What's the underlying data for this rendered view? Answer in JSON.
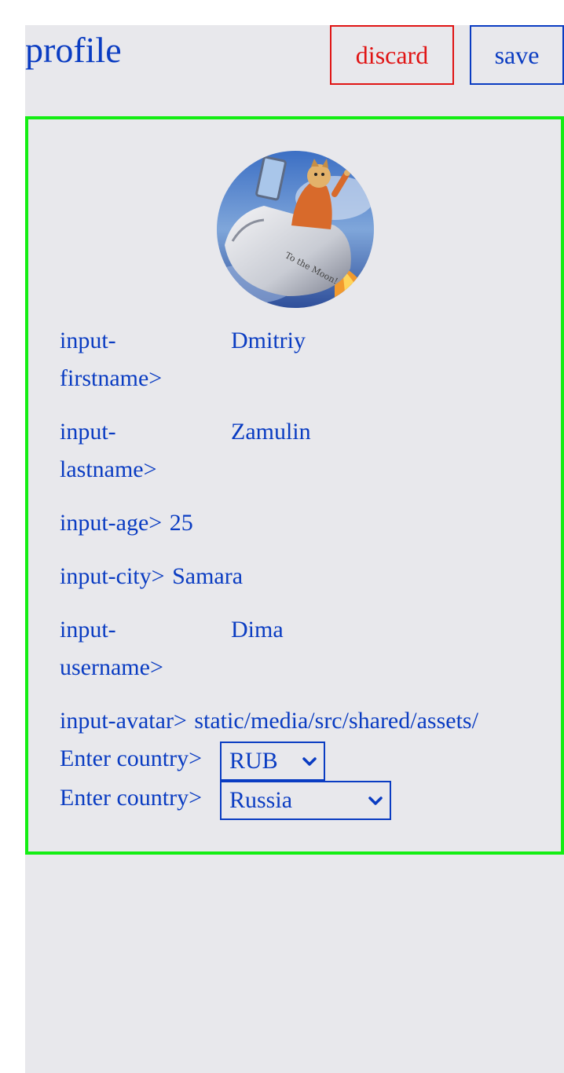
{
  "header": {
    "title": "profile",
    "discard_label": "discard",
    "save_label": "save"
  },
  "profile": {
    "avatar_icon": "doge-rocket-avatar",
    "firstname": {
      "label_line1": "input-",
      "label_line2": "firstname>",
      "value": "Dmitriy"
    },
    "lastname": {
      "label_line1": "input-",
      "label_line2": "lastname>",
      "value": "Zamulin"
    },
    "age": {
      "label": "input-age>",
      "value": "25"
    },
    "city": {
      "label": "input-city>",
      "value": "Samara"
    },
    "username": {
      "label_line1": "input-",
      "label_line2": "username>",
      "value": "Dima"
    },
    "avatar": {
      "label": "input-avatar>",
      "value": "static/media/src/shared/assets/"
    },
    "currency": {
      "label": "Enter country>",
      "selected": "RUB"
    },
    "country": {
      "label": "Enter country>",
      "selected": "Russia"
    }
  },
  "colors": {
    "accent": "#0a3cc2",
    "danger": "#e01414",
    "card_border": "#13ee13",
    "page_bg": "#e8e8ec"
  }
}
